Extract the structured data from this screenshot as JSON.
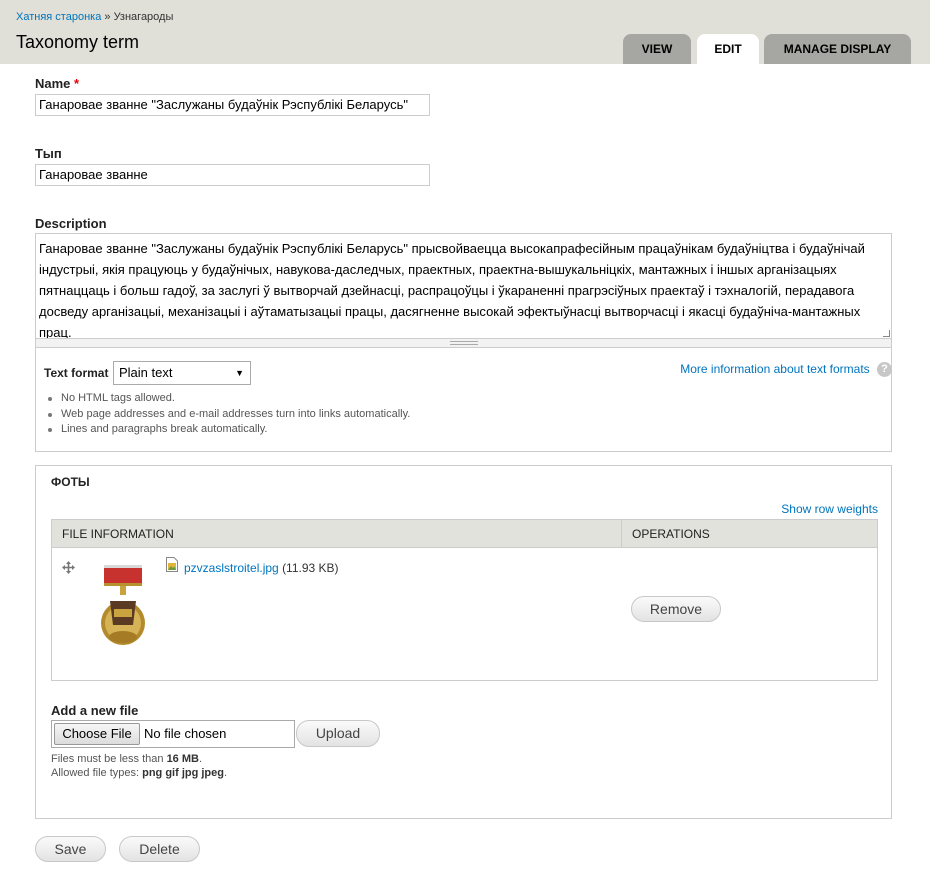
{
  "breadcrumb": {
    "home": "Хатняя старонка",
    "separator": "»",
    "current": "Узнагароды"
  },
  "page_title": "Taxonomy term",
  "tabs": [
    {
      "label": "View",
      "active": false
    },
    {
      "label": "Edit",
      "active": true
    },
    {
      "label": "Manage display",
      "active": false
    }
  ],
  "form": {
    "name": {
      "label": "Name",
      "required_mark": "*",
      "value": "Ганаровае званне \"Заслужаны будаўнік Рэспублікі Беларусь\""
    },
    "type": {
      "label": "Тып",
      "value": "Ганаровае званне"
    },
    "description": {
      "label": "Description",
      "value": "Ганаровае званне \"Заслужаны будаўнік Рэспублікі Беларусь\" прысвойваецца высокапрафесійным працаўнікам будаўніцтва і будаўнічай індустрыі, якія працуюць у будаўнічых, навукова-даследчых, праектных, праектна-вышукальніцкіх, мантажных і іншых арганізацыях пятнаццаць і больш гадоў, за заслугі ў вытворчай дзейнасці, распрацоўцы і ўкараненні прагрэсіўных праектаў і тэхналогій, перадавога досведу арганізацыі, механізацыі і аўтаматызацыі працы, дасягненне высокай эфектыўнасці вытворчасці і якасці будаўніча-мантажных прац."
    },
    "text_format": {
      "label": "Text format",
      "selected": "Plain text",
      "more_info_link": "More information about text formats",
      "help_icon": "question-icon",
      "tips": [
        "No HTML tags allowed.",
        "Web page addresses and e-mail addresses turn into links automatically.",
        "Lines and paragraphs break automatically."
      ]
    },
    "photos": {
      "legend": "ФОТЫ",
      "show_row_weights": "Show row weights",
      "columns": [
        "File information",
        "Operations"
      ],
      "file": {
        "name": "pzvzaslstroitel.jpg",
        "size": "(11.93 KB)",
        "remove_label": "Remove"
      },
      "add_new": {
        "label": "Add a new file",
        "choose_label": "Choose File",
        "no_file": "No file chosen",
        "upload_label": "Upload",
        "size_prefix": "Files must be less than",
        "size_value": "16 MB",
        "size_suffix": ".",
        "types_prefix": "Allowed file types:",
        "types_value": "png gif jpg jpeg",
        "types_suffix": "."
      }
    },
    "actions": {
      "save": "Save",
      "delete": "Delete"
    }
  }
}
